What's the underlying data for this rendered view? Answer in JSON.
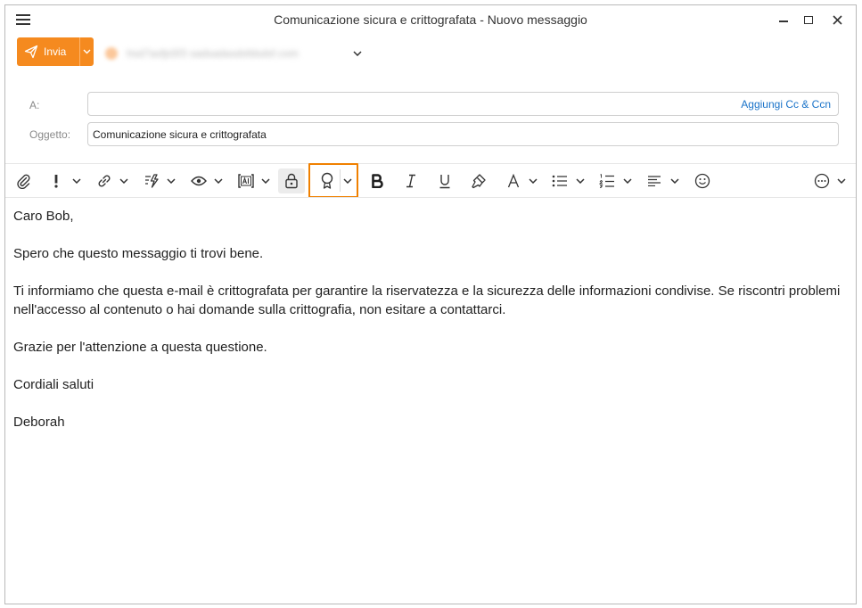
{
  "window": {
    "title": "Comunicazione sicura e crittografata - Nuovo messaggio",
    "controls": [
      "minimize",
      "maximize",
      "close"
    ]
  },
  "compose": {
    "send_label": "Invia",
    "sender_blurred": "hsd7asfjs5f3 sadsadasdsfdsdsf.com",
    "to_label": "A:",
    "to_value": "",
    "add_cc_label": "Aggiungi Cc & Ccn",
    "subject_label": "Oggetto:",
    "subject_value": "Comunicazione sicura e crittografata"
  },
  "toolbar": {
    "items": [
      "attach-icon",
      "importance-icon",
      "link-icon",
      "quick-steps-icon",
      "view-icon",
      "ai-icon",
      "lock-icon",
      "certificate-icon",
      "bold-icon",
      "italic-icon",
      "underline-icon",
      "format-painter-icon",
      "font-color-icon",
      "bullet-list-icon",
      "numbered-list-icon",
      "align-icon",
      "emoji-icon",
      "more-icon"
    ],
    "highlight_color": "#f08000",
    "send_color": "#f58a1f",
    "link_color": "#1a73c9"
  },
  "message": {
    "greeting": "Caro Bob,",
    "para1": "Spero che questo messaggio ti trovi bene.",
    "para2": "Ti informiamo che questa e-mail è crittografata per garantire la riservatezza e la sicurezza delle informazioni condivise. Se riscontri problemi nell'accesso al contenuto o hai domande sulla crittografia, non esitare a contattarci.",
    "para3": "Grazie per l'attenzione a questa questione.",
    "closing": "Cordiali saluti",
    "signature": "Deborah"
  }
}
